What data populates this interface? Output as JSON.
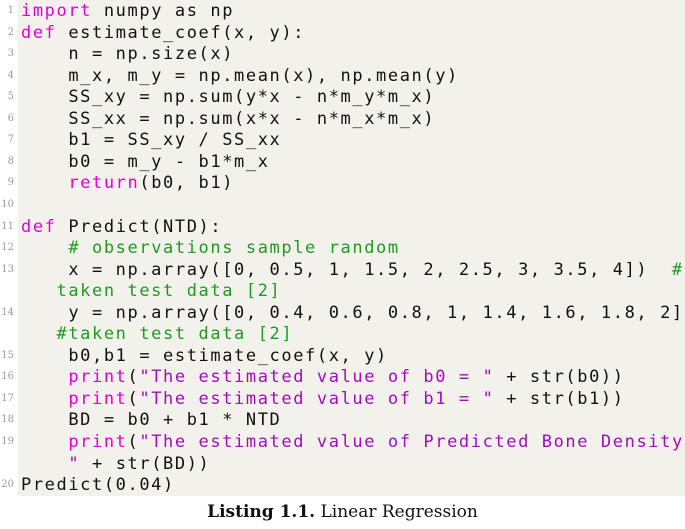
{
  "listing": {
    "colors": {
      "background": "#f2f1ec",
      "keyword": "#e600d6",
      "string": "#a40bc0",
      "comment": "#1f9a1f",
      "line_number": "#9a9a9a",
      "text": "#111111"
    },
    "lines": [
      {
        "n": "1",
        "segments": [
          {
            "t": "kw",
            "v": "import"
          },
          {
            "t": "",
            "v": " numpy as np"
          }
        ]
      },
      {
        "n": "2",
        "segments": [
          {
            "t": "kw",
            "v": "def"
          },
          {
            "t": "",
            "v": " estimate_coef(x, y):"
          }
        ]
      },
      {
        "n": "3",
        "segments": [
          {
            "t": "",
            "v": "    n = np.size(x)"
          }
        ]
      },
      {
        "n": "4",
        "segments": [
          {
            "t": "",
            "v": "    m_x, m_y = np.mean(x), np.mean(y)"
          }
        ]
      },
      {
        "n": "5",
        "segments": [
          {
            "t": "",
            "v": "    SS_xy = np.sum(y*x - n*m_y*m_x)"
          }
        ]
      },
      {
        "n": "6",
        "segments": [
          {
            "t": "",
            "v": "    SS_xx = np.sum(x*x - n*m_x*m_x)"
          }
        ]
      },
      {
        "n": "7",
        "segments": [
          {
            "t": "",
            "v": "    b1 = SS_xy / SS_xx"
          }
        ]
      },
      {
        "n": "8",
        "segments": [
          {
            "t": "",
            "v": "    b0 = m_y - b1*m_x"
          }
        ]
      },
      {
        "n": "9",
        "segments": [
          {
            "t": "",
            "v": "    "
          },
          {
            "t": "kw",
            "v": "return"
          },
          {
            "t": "",
            "v": "(b0, b1)"
          }
        ]
      },
      {
        "n": "10",
        "segments": [
          {
            "t": "",
            "v": ""
          }
        ]
      },
      {
        "n": "11",
        "segments": [
          {
            "t": "kw",
            "v": "def"
          },
          {
            "t": "",
            "v": " Predict(NTD):"
          }
        ]
      },
      {
        "n": "12",
        "segments": [
          {
            "t": "",
            "v": "    "
          },
          {
            "t": "cm",
            "v": "# observations sample random"
          }
        ]
      },
      {
        "n": "13",
        "segments": [
          {
            "t": "",
            "v": "    x = np.array([0, 0.5, 1, 1.5, 2, 2.5, 3, 3.5, 4])  "
          },
          {
            "t": "cm",
            "v": "#"
          }
        ]
      },
      {
        "n": "",
        "segments": [
          {
            "t": "cm",
            "v": "   taken test data [2]"
          }
        ]
      },
      {
        "n": "14",
        "segments": [
          {
            "t": "",
            "v": "    y = np.array([0, 0.4, 0.6, 0.8, 1, 1.4, 1.6, 1.8, 2])"
          }
        ]
      },
      {
        "n": "",
        "segments": [
          {
            "t": "cm",
            "v": "   #taken test data [2]"
          }
        ]
      },
      {
        "n": "15",
        "segments": [
          {
            "t": "",
            "v": "    b0,b1 = estimate_coef(x, y)"
          }
        ]
      },
      {
        "n": "16",
        "segments": [
          {
            "t": "",
            "v": "    "
          },
          {
            "t": "kw",
            "v": "print"
          },
          {
            "t": "",
            "v": "("
          },
          {
            "t": "str",
            "v": "\"The estimated value of b0 = \""
          },
          {
            "t": "",
            "v": " + str(b0))"
          }
        ]
      },
      {
        "n": "17",
        "segments": [
          {
            "t": "",
            "v": "    "
          },
          {
            "t": "kw",
            "v": "print"
          },
          {
            "t": "",
            "v": "("
          },
          {
            "t": "str",
            "v": "\"The estimated value of b1 = \""
          },
          {
            "t": "",
            "v": " + str(b1))"
          }
        ]
      },
      {
        "n": "18",
        "segments": [
          {
            "t": "",
            "v": "    BD = b0 + b1 * NTD"
          }
        ]
      },
      {
        "n": "19",
        "segments": [
          {
            "t": "",
            "v": "    "
          },
          {
            "t": "kw",
            "v": "print"
          },
          {
            "t": "",
            "v": "("
          },
          {
            "t": "str",
            "v": "\"The estimated value of Predicted Bone Density ="
          }
        ]
      },
      {
        "n": "",
        "segments": [
          {
            "t": "str",
            "v": "    \""
          },
          {
            "t": "",
            "v": " + str(BD))"
          }
        ]
      },
      {
        "n": "20",
        "segments": [
          {
            "t": "",
            "v": "Predict(0.04)"
          }
        ]
      }
    ]
  },
  "caption": {
    "label": "Listing 1.1.",
    "text": " Linear Regression"
  }
}
